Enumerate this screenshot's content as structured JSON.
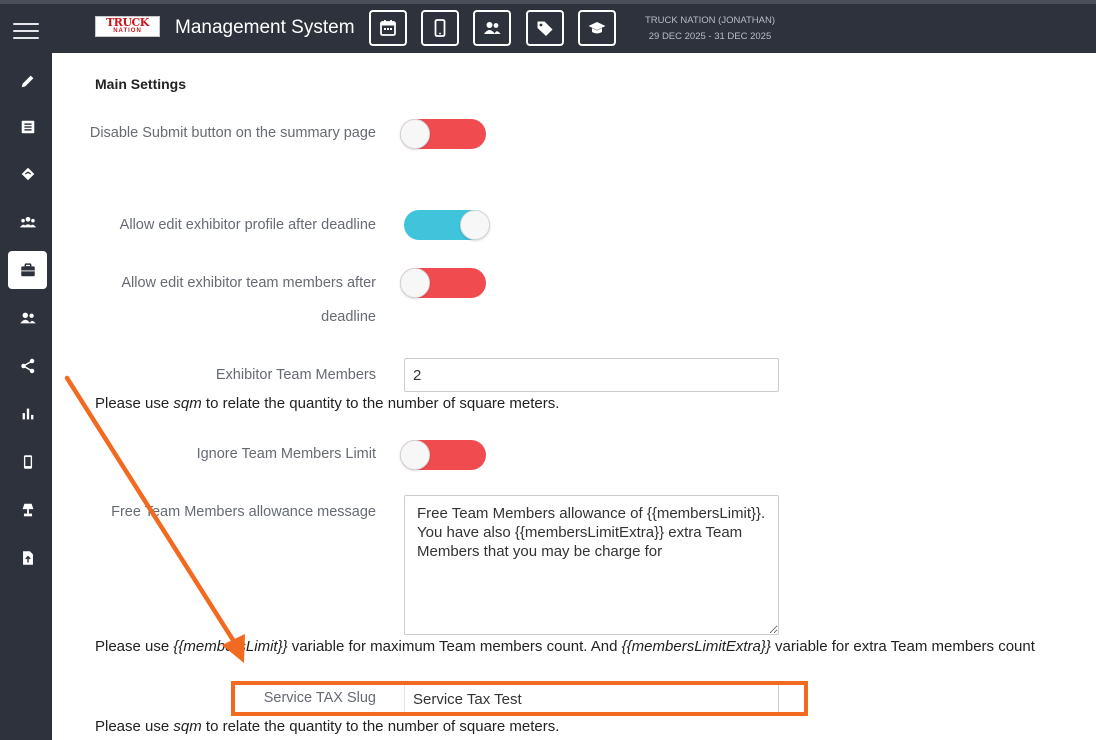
{
  "header": {
    "logo": {
      "line1": "TRUCK",
      "line2": "NATION"
    },
    "app_title": "Management System",
    "top_icons": [
      "calendar-icon",
      "mobile-icon",
      "users-icon",
      "tag-icon",
      "graduation-cap-icon"
    ],
    "event_name": "TRUCK NATION (JONATHAN)",
    "event_dates": "29 DEC 2025 - 31 DEC 2025"
  },
  "sidebar": {
    "items": [
      "pencil-icon",
      "list-icon",
      "handshake-icon",
      "group-icon",
      "briefcase-icon",
      "user-friends-icon",
      "share-icon",
      "bar-chart-icon",
      "mobile-icon",
      "lamp-icon",
      "file-upload-icon"
    ],
    "active_index": 4
  },
  "main": {
    "section_title": "Main Settings",
    "settings": {
      "disable_submit": {
        "label": "Disable Submit button on the summary page",
        "state": "off"
      },
      "allow_edit_profile": {
        "label": "Allow edit exhibitor profile after deadline",
        "state": "on"
      },
      "allow_edit_team": {
        "label": "Allow edit exhibitor team members after deadline",
        "state": "off"
      },
      "team_members": {
        "label": "Exhibitor Team Members",
        "value": "2"
      },
      "team_members_help": {
        "pre": "Please use ",
        "var": "sqm",
        "post": " to relate the quantity to the number of square meters."
      },
      "ignore_limit": {
        "label": "Ignore Team Members Limit",
        "state": "off"
      },
      "allowance_message": {
        "label": "Free Team Members allowance message",
        "value": "Free Team Members allowance of {{membersLimit}}. You have also {{membersLimitExtra}} extra Team Members that you may be charge for"
      },
      "allowance_help": {
        "p1": "Please use ",
        "v1": "{{membersLimit}}",
        "p2": " variable for maximum Team members count. And ",
        "v2": "{{membersLimitExtra}}",
        "p3": " variable for extra Team members count"
      },
      "service_tax_slug": {
        "label": "Service TAX Slug",
        "value": "Service Tax Test"
      },
      "service_tax_help": {
        "pre": "Please use ",
        "var": "sqm",
        "post": " to relate the quantity to the number of square meters."
      }
    }
  },
  "colors": {
    "sidebar": "#2e323c",
    "toggle_off": "#f04c50",
    "toggle_on": "#3fc4dc",
    "annotation": "#f26a1f"
  }
}
